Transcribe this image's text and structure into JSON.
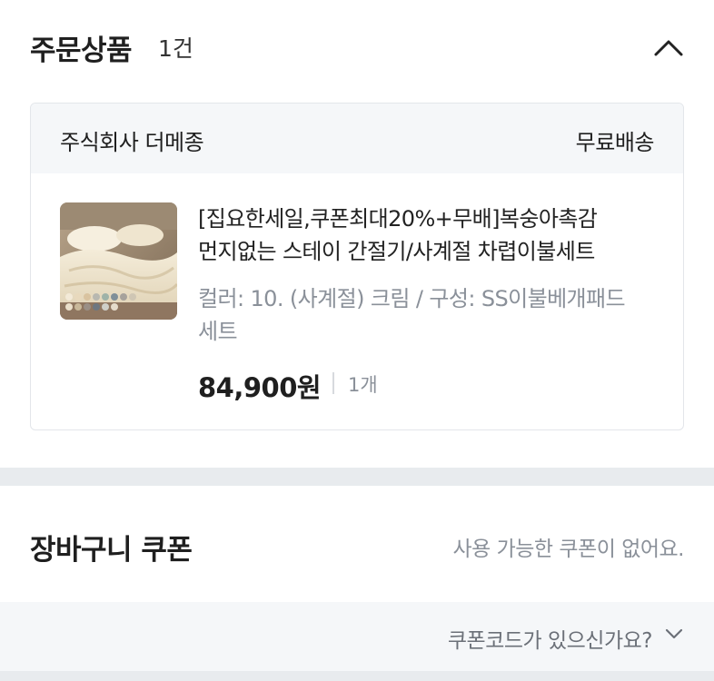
{
  "order_items": {
    "title": "주문상품",
    "count": "1건",
    "collapse_icon": "chevron-up-icon"
  },
  "seller_card": {
    "seller_name": "주식회사 더메종",
    "shipping": "무료배송",
    "product": {
      "thumbnail_icon": "product-thumbnail",
      "name_line1": "[집요한세일,쿠폰최대20%+무배]복숭아촉감",
      "name_line2": "먼지없는 스테이 간절기/사계절 차렵이불세트",
      "option_line1": "컬러: 10. (사계절) 크림 / 구성: SS이불베개패드",
      "option_line2": "세트",
      "price": "84,900원",
      "quantity": "1개"
    }
  },
  "cart_coupon": {
    "title": "장바구니 쿠폰",
    "status": "사용 가능한 쿠폰이 없어요.",
    "code_prompt": "쿠폰코드가 있으신가요?",
    "code_icon": "chevron-down-icon"
  },
  "colors": {
    "accent_text": "#1f1f1f",
    "muted_text": "#8a9099",
    "panel_bg": "#f5f7f9",
    "divider_band": "#e8ebee"
  }
}
